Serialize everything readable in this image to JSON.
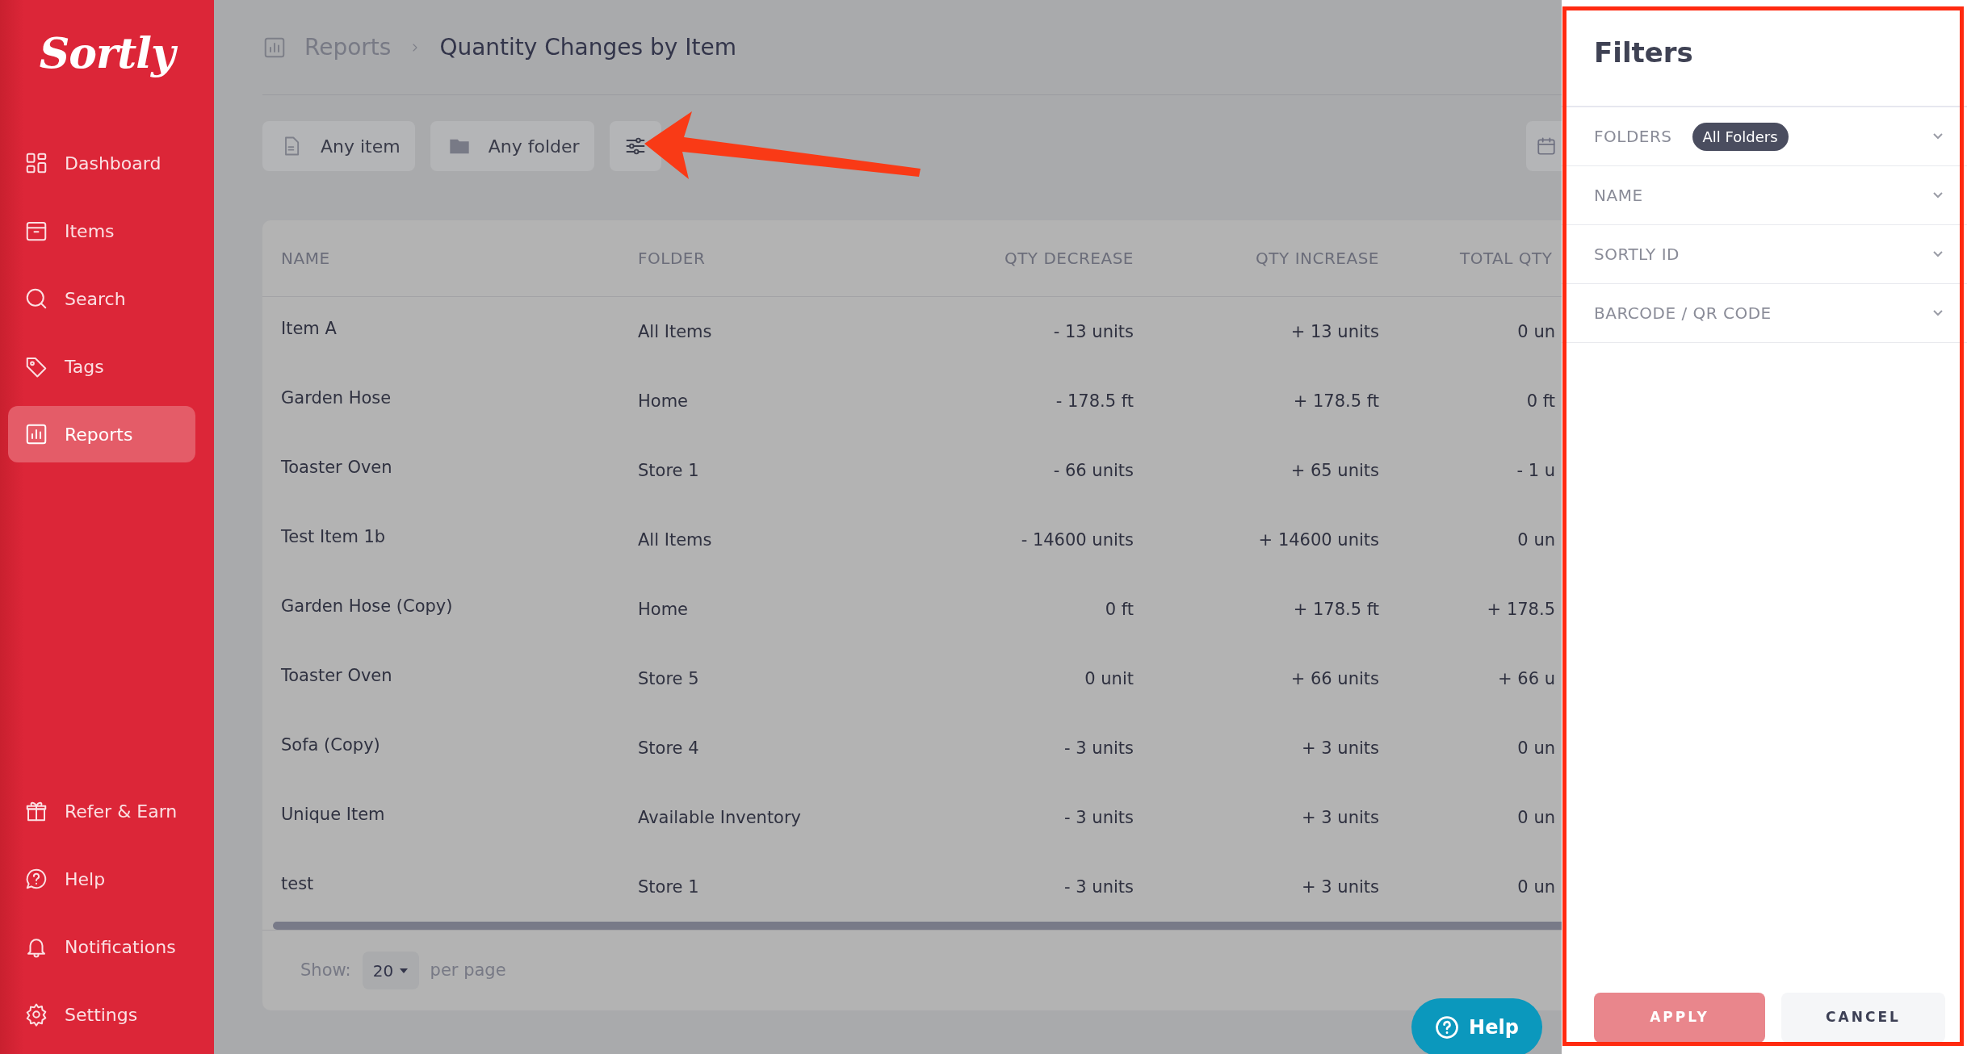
{
  "sidebar": {
    "logo": "Sortly",
    "items": [
      {
        "label": "Dashboard",
        "selected": false
      },
      {
        "label": "Items",
        "selected": false
      },
      {
        "label": "Search",
        "selected": false
      },
      {
        "label": "Tags",
        "selected": false
      },
      {
        "label": "Reports",
        "selected": true
      }
    ],
    "bottom_items": [
      {
        "label": "Refer & Earn",
        "selected": false
      },
      {
        "label": "Help",
        "selected": false
      },
      {
        "label": "Notifications",
        "selected": false
      },
      {
        "label": "Settings",
        "selected": false
      }
    ]
  },
  "breadcrumb": {
    "parent": "Reports",
    "current": "Quantity Changes by Item"
  },
  "toolbar": {
    "buttons": [
      "Any item",
      "Any folder"
    ]
  },
  "table": {
    "columns": [
      "NAME",
      "FOLDER",
      "QTY DECREASE",
      "QTY INCREASE",
      "TOTAL QTY"
    ],
    "rows": [
      [
        "Item A",
        "All Items",
        "- 13 units",
        "+ 13 units",
        "0 un"
      ],
      [
        "Garden Hose",
        "Home",
        "- 178.5 ft",
        "+ 178.5 ft",
        "0 ft"
      ],
      [
        "Toaster Oven",
        "Store 1",
        "- 66 units",
        "+ 65 units",
        "- 1 u"
      ],
      [
        "Test Item 1b",
        "All Items",
        "- 14600 units",
        "+ 14600 units",
        "0 un"
      ],
      [
        "Garden Hose (Copy)",
        "Home",
        "0 ft",
        "+ 178.5 ft",
        "+ 178.5"
      ],
      [
        "Toaster Oven",
        "Store 5",
        "0 unit",
        "+ 66 units",
        "+ 66 u"
      ],
      [
        "Sofa (Copy)",
        "Store 4",
        "- 3 units",
        "+ 3 units",
        "0 un"
      ],
      [
        "Unique Item",
        "Available Inventory",
        "- 3 units",
        "+ 3 units",
        "0 un"
      ],
      [
        "test",
        "Store 1",
        "- 3 units",
        "+ 3 units",
        "0 un"
      ]
    ]
  },
  "pagination": {
    "label": "Show:",
    "value": "20",
    "suffix": "per page"
  },
  "help_button": {
    "label": "Help"
  },
  "filters": {
    "title": "Filters",
    "sections": [
      {
        "label": "FOLDERS",
        "badge": "All Folders"
      },
      {
        "label": "NAME"
      },
      {
        "label": "SORTLY ID"
      },
      {
        "label": "BARCODE / QR CODE"
      }
    ],
    "buttons": [
      {
        "label": "APPLY",
        "disabled": true
      },
      {
        "label": "CANCEL",
        "disabled": false
      }
    ]
  }
}
